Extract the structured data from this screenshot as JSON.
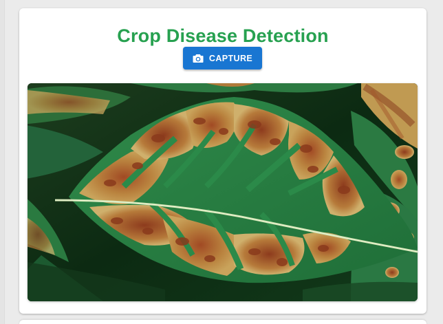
{
  "page": {
    "title": "Crop Disease Detection"
  },
  "toolbar": {
    "capture_label": "CAPTURE",
    "capture_icon": "camera-icon"
  },
  "preview": {
    "subject": "diseased-leaf-photo"
  },
  "colors": {
    "title": "#27a150",
    "button": "#1976d2",
    "card": "#ffffff",
    "background": "#ebebeb"
  }
}
